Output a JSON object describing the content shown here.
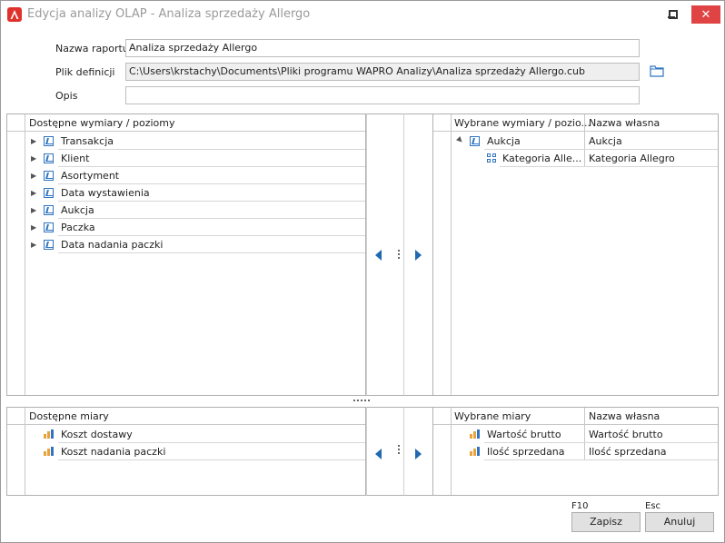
{
  "window": {
    "title": "Edycja analizy OLAP - Analiza sprzedaży Allergo",
    "minimize": "▬",
    "maximize": "□",
    "close": "✕"
  },
  "form": {
    "report_name_label": "Nazwa raportu",
    "report_name_value": "Analiza sprzedaży Allergo",
    "definition_file_label": "Plik definicji",
    "definition_file_value": "C:\\Users\\krstachy\\Documents\\Pliki programu WAPRO Analizy\\Analiza sprzedaży Allergo.cub",
    "description_label": "Opis",
    "description_value": ""
  },
  "available_dimensions": {
    "header": "Dostępne wymiary / poziomy",
    "items": [
      {
        "label": "Transakcja"
      },
      {
        "label": "Klient"
      },
      {
        "label": "Asortyment"
      },
      {
        "label": "Data wystawienia"
      },
      {
        "label": "Aukcja"
      },
      {
        "label": "Paczka"
      },
      {
        "label": "Data nadania paczki"
      }
    ]
  },
  "selected_dimensions": {
    "header_name": "Wybrane wymiary / pozio...",
    "header_own": "Nazwa własna",
    "rows": [
      {
        "name": "Aukcja",
        "own": "Aukcja"
      },
      {
        "name": "Kategoria Alle...",
        "own": "Kategoria Allegro"
      }
    ]
  },
  "available_measures": {
    "header": "Dostępne miary",
    "items": [
      {
        "label": "Koszt dostawy"
      },
      {
        "label": "Koszt nadania paczki"
      }
    ]
  },
  "selected_measures": {
    "header_name": "Wybrane miary",
    "header_own": "Nazwa własna",
    "rows": [
      {
        "name": "Wartość brutto",
        "own": "Wartość brutto"
      },
      {
        "name": "Ilość sprzedana",
        "own": "Ilość sprzedana"
      }
    ]
  },
  "footer": {
    "save_key": "F10",
    "save_label": "Zapisz",
    "cancel_key": "Esc",
    "cancel_label": "Anuluj"
  },
  "colors": {
    "accent": "#1f69b3",
    "close_button": "#e04343",
    "app_icon": "#e0322c"
  },
  "icons": {
    "folder": "folder-icon",
    "dimension": "dimension-icon",
    "measure": "measure-icon",
    "level": "level-icon"
  }
}
